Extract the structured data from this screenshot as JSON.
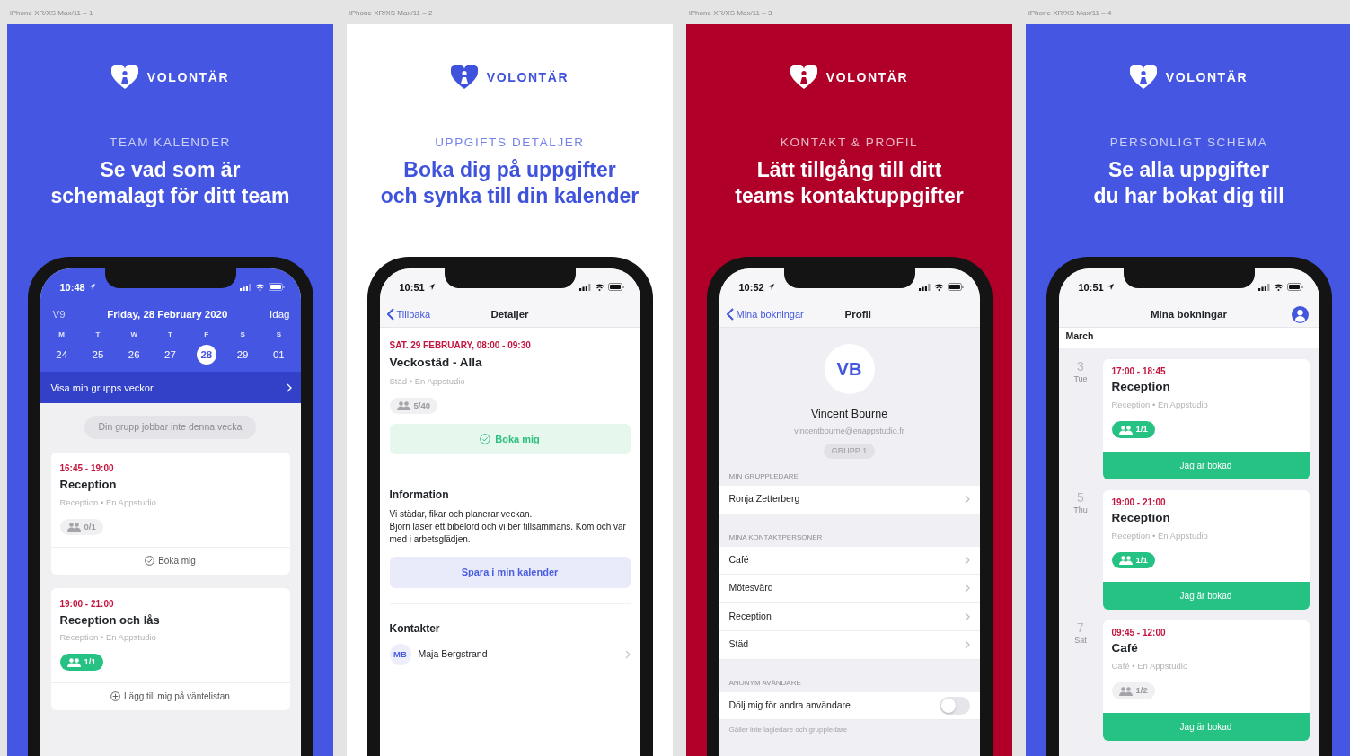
{
  "artboards": [
    {
      "label": "iPhone XR/XS Max/11 – 1",
      "color": "#4456e2",
      "brand": "VOLONTÄR",
      "kicker": "TEAM KALENDER",
      "headline": [
        "Se vad som är",
        "schemalagt för ditt team"
      ],
      "screen": {
        "kind": "calendar",
        "time": "10:48",
        "week": "V9",
        "date": "Friday, 28 February 2020",
        "today": "Idag",
        "days": [
          {
            "letter": "M",
            "date": "24",
            "selected": false
          },
          {
            "letter": "T",
            "date": "25",
            "selected": false
          },
          {
            "letter": "W",
            "date": "26",
            "selected": false
          },
          {
            "letter": "T",
            "date": "27",
            "selected": false
          },
          {
            "letter": "F",
            "date": "28",
            "selected": true
          },
          {
            "letter": "S",
            "date": "29",
            "selected": false
          },
          {
            "letter": "S",
            "date": "01",
            "selected": false
          }
        ],
        "group_link": "Visa min grupps veckor",
        "notice": "Din grupp jobbar inte denna vecka",
        "shifts": [
          {
            "time": "16:45 - 19:00",
            "title": "Reception",
            "meta": "Reception • En Appstudio",
            "count": "0/1",
            "full": false,
            "action": {
              "kind": "book",
              "label": "Boka mig"
            }
          },
          {
            "time": "19:00 - 21:00",
            "title": "Reception och lås",
            "meta": "Reception • En Appstudio",
            "count": "1/1",
            "full": true,
            "action": {
              "kind": "waitlist",
              "label": "Lägg till mig på väntelistan"
            }
          }
        ]
      }
    },
    {
      "label": "iPhone XR/XS Max/11 – 2",
      "color": "#ffffff",
      "brand": "VOLONTÄR",
      "kicker": "UPPGIFTS DETALJER",
      "headline": [
        "Boka dig på uppgifter",
        "och synka till din kalender"
      ],
      "screen": {
        "kind": "details",
        "time": "10:51",
        "back": "Tillbaka",
        "title": "Detaljer",
        "when": "SAT. 29 FEBRUARY, 08:00 - 09:30",
        "name": "Veckostäd - Alla",
        "meta": "Städ • En Appstudio",
        "count": "5/40",
        "full": false,
        "book": "Boka mig",
        "info_heading": "Information",
        "info": [
          "Vi städar, fikar och planerar veckan.",
          "Björn läser ett bibelord och vi ber tillsammans. Kom och var med i arbetsglädjen."
        ],
        "save": "Spara i min kalender",
        "contacts_heading": "Kontakter",
        "contacts": [
          {
            "initials": "MB",
            "name": "Maja Bergstrand"
          }
        ]
      }
    },
    {
      "label": "iPhone XR/XS Max/11 – 3",
      "color": "#b0002a",
      "brand": "VOLONTÄR",
      "kicker": "KONTAKT & PROFIL",
      "headline": [
        "Lätt tillgång till ditt",
        "teams kontaktuppgifter"
      ],
      "screen": {
        "kind": "profile",
        "time": "10:52",
        "back": "Mina bokningar",
        "title": "Profil",
        "initials": "VB",
        "name": "Vincent Bourne",
        "email": "vincentbourne@enappstudio.fr",
        "group": "GRUPP 1",
        "sections": [
          {
            "heading": "MIN GRUPPLEDARE",
            "rows": [
              {
                "kind": "link",
                "label": "Ronja Zetterberg"
              }
            ]
          },
          {
            "heading": "MINA KONTAKTPERSONER",
            "rows": [
              {
                "kind": "link",
                "label": "Café"
              },
              {
                "kind": "link",
                "label": "Mötesvärd"
              },
              {
                "kind": "link",
                "label": "Reception"
              },
              {
                "kind": "link",
                "label": "Städ"
              }
            ]
          },
          {
            "heading": "ANONYM AVÄNDARE",
            "rows": [
              {
                "kind": "toggle",
                "label": "Dölj mig för andra användare",
                "on": false
              }
            ],
            "footer": "Gäller inte lagledare och gruppledare"
          }
        ]
      }
    },
    {
      "label": "iPhone XR/XS Max/11 – 4",
      "color": "#4456e2",
      "brand": "VOLONTÄR",
      "kicker": "PERSONLIGT SCHEMA",
      "headline": [
        "Se alla uppgifter",
        "du har bokat dig till"
      ],
      "screen": {
        "kind": "bookings",
        "time": "10:51",
        "title": "Mina bokningar",
        "month": "March",
        "bookings": [
          {
            "day": "3",
            "weekday": "Tue",
            "time": "17:00 - 18:45",
            "title": "Reception",
            "meta": "Reception • En Appstudio",
            "count": "1/1",
            "full": true,
            "status": "Jag är bokad"
          },
          {
            "day": "5",
            "weekday": "Thu",
            "time": "19:00 - 21:00",
            "title": "Reception",
            "meta": "Reception • En Appstudio",
            "count": "1/1",
            "full": true,
            "status": "Jag är bokad"
          },
          {
            "day": "7",
            "weekday": "Sat",
            "time": "09:45 - 12:00",
            "title": "Café",
            "meta": "Café • En Appstudio",
            "count": "1/2",
            "full": false,
            "status": "Jag är bokad"
          }
        ]
      }
    }
  ]
}
